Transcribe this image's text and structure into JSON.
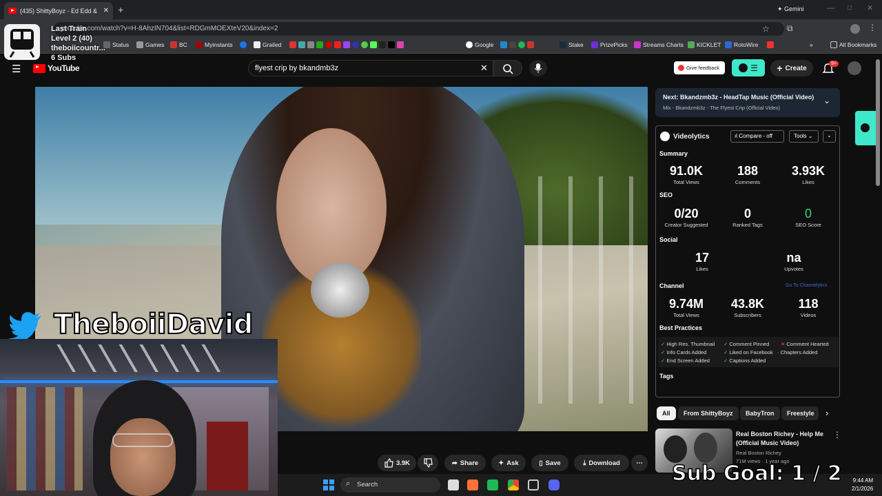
{
  "browser": {
    "tab_title": "(435) ShittyBoyz - Ed Edd &",
    "gemini_label": "Gemini",
    "url": "youtube.com/watch?v=H-8AhzIN704&list=RDGmMOEXteV20&index=2",
    "all_bookmarks": "All Bookmarks",
    "bookmarks": [
      "Status",
      "Games",
      "BC",
      "Myinstants",
      "Grailed",
      "Stake",
      "PrizePicks",
      "Streams Charts",
      "KICKLET",
      "RotoWire",
      "Google"
    ]
  },
  "stream_overlay": {
    "train_label": "Last Train",
    "level": "Level 2  (40)",
    "channel": "theboiicountr...",
    "subs": "6 Subs",
    "handle": "TheboiiDavid",
    "sub_goal": "Sub Goal:  1 / 2"
  },
  "youtube": {
    "logo": "YouTube",
    "search_value": "flyest crip by bkandmb3z",
    "give_feedback": "Give feedback",
    "create": "Create",
    "notif_badge": "9+",
    "next_label": "Next:",
    "next_title": "Bkandzmb3z - HeadTap Music (Official Video)",
    "next_sub": "Mix - Bkandzmb3z - The Flyest Crip (Official Video)",
    "actions": {
      "likes": "3.9K",
      "share": "Share",
      "ask": "Ask",
      "save": "Save",
      "download": "Download"
    },
    "chips": [
      "All",
      "From ShittyBoyz",
      "BabyTron",
      "Freestyle"
    ],
    "rec": {
      "title": "Real Boston Richey - Help Me (Official Music Video)",
      "channel": "Real Boston Richey",
      "meta": "71M views · 1 year ago"
    }
  },
  "videolytics": {
    "title": "Videolytics",
    "compare": "Compare - off",
    "tools": "Tools",
    "summary_label": "Summary",
    "summary": [
      {
        "value": "91.0K",
        "label": "Total Views"
      },
      {
        "value": "188",
        "label": "Comments"
      },
      {
        "value": "3.93K",
        "label": "Likes"
      }
    ],
    "seo_label": "SEO",
    "seo": [
      {
        "value": "0/20",
        "label": "Creator Suggested"
      },
      {
        "value": "0",
        "label": "Ranked Tags"
      },
      {
        "value": "0",
        "label": "SEO Score"
      }
    ],
    "social_label": "Social",
    "social": [
      {
        "value": "17",
        "label": "Likes"
      },
      {
        "value": "na",
        "label": "Upvotes"
      }
    ],
    "channel_label": "Channel",
    "channelytics_link": "Go To Channelytics",
    "channel": [
      {
        "value": "9.74M",
        "label": "Total Views"
      },
      {
        "value": "43.8K",
        "label": "Subscribers"
      },
      {
        "value": "118",
        "label": "Videos"
      }
    ],
    "best_practices_label": "Best Practices",
    "best_practices": [
      "High Res. Thumbnail",
      "Comment Pinned",
      "Comment Hearted",
      "Info Cards Added",
      "Liked on Facebook",
      "Chapters Added",
      "End Screen Added",
      "Captions Added"
    ],
    "tags_label": "Tags"
  },
  "taskbar": {
    "search": "Search",
    "time": "9:44 AM",
    "date": "2/1/2026"
  }
}
